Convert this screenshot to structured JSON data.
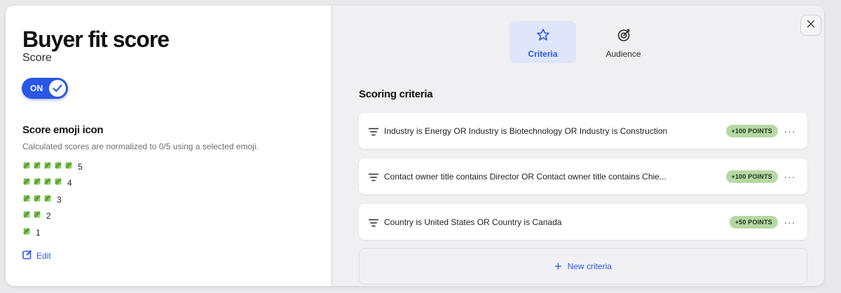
{
  "left_panel": {
    "title": "Buyer fit score",
    "subtitle": "Score",
    "toggle": {
      "label": "ON",
      "checked": true
    },
    "emoji_section": {
      "title": "Score emoji icon",
      "description": "Calculated scores are normalized to 0/5 using a selected emoji.",
      "emoji_icon": "clover-icon",
      "rows": [
        {
          "count": 5,
          "label": "5"
        },
        {
          "count": 4,
          "label": "4"
        },
        {
          "count": 3,
          "label": "3"
        },
        {
          "count": 2,
          "label": "2"
        },
        {
          "count": 1,
          "label": "1"
        }
      ]
    },
    "edit_label": "Edit"
  },
  "tabs": [
    {
      "label": "Criteria",
      "icon": "star-icon",
      "active": true
    },
    {
      "label": "Audience",
      "icon": "target-icon",
      "active": false
    }
  ],
  "criteria_section": {
    "title": "Scoring criteria",
    "items": [
      {
        "text": "Industry is Energy OR Industry is Biotechnology OR Industry is Construction",
        "points": "+100 POINTS"
      },
      {
        "text": "Contact owner title contains Director OR Contact owner title contains Chie...",
        "points": "+100 POINTS"
      },
      {
        "text": "Country is United States OR Country is Canada",
        "points": "+50 POINTS"
      }
    ],
    "new_label": "New criteria"
  },
  "colors": {
    "accent": "#2a57e6",
    "badge_bg": "#b6d8a4",
    "active_tab_bg": "#dfe6fb"
  }
}
